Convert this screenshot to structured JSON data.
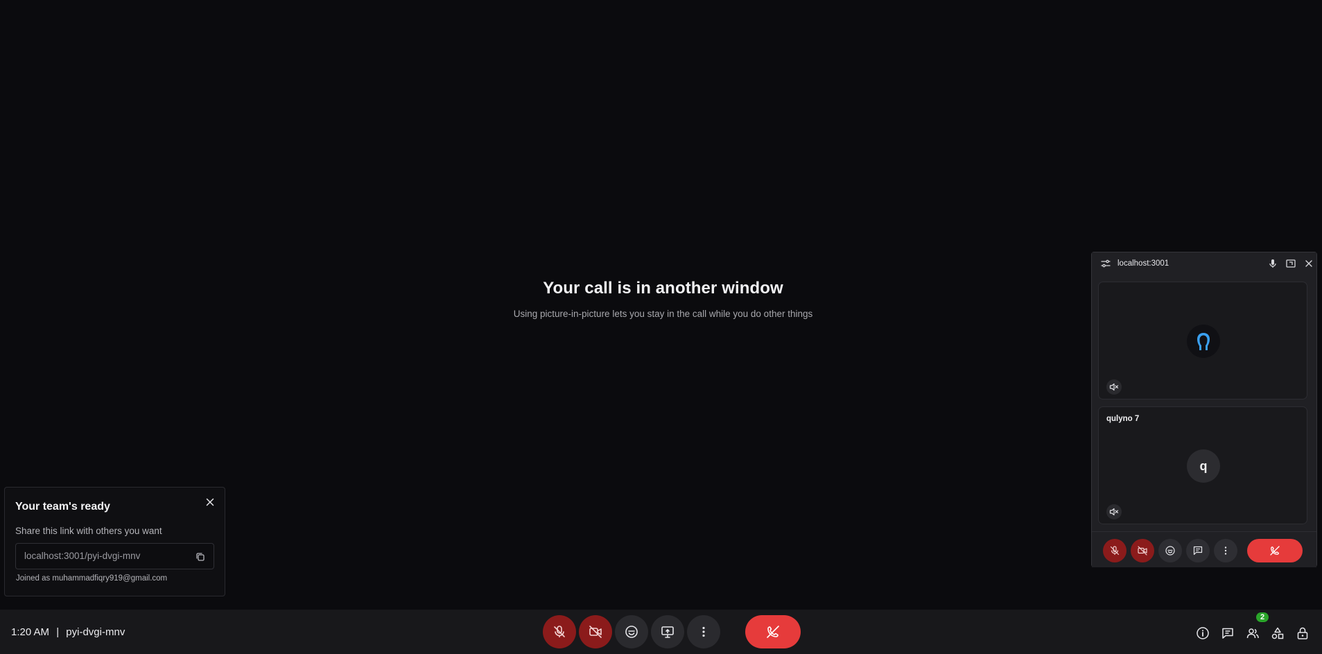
{
  "main": {
    "title": "Your call is in another window",
    "subtitle": "Using picture-in-picture lets you stay in the call while you do other things"
  },
  "team_card": {
    "title": "Your team's ready",
    "description": "Share this link with others you want",
    "link": "localhost:3001/pyi-dvgi-mnv",
    "joined": "Joined as muhammadfiqry919@gmail.com"
  },
  "bottom_bar": {
    "time": "1:20 AM",
    "separator": "|",
    "meeting_code": "pyi-dvgi-mnv",
    "participants_count": "2",
    "controls": [
      "mic-off-icon",
      "camera-off-icon",
      "emoji-icon",
      "present-screen-icon",
      "more-vert-icon",
      "end-call-icon"
    ],
    "right_icons": [
      "info-icon",
      "chat-icon",
      "people-icon",
      "activities-icon",
      "lock-icon"
    ]
  },
  "pip": {
    "title": "localhost:3001",
    "tiles": [
      {
        "name": "",
        "avatar_type": "image"
      },
      {
        "name": "qulyno 7",
        "avatar_letter": "q"
      }
    ]
  },
  "colors": {
    "background": "#0b0b0e",
    "bar": "#18181b",
    "red_button": "#8b1b1b",
    "end_call": "#e63b3b",
    "badge": "#2aa52a"
  }
}
